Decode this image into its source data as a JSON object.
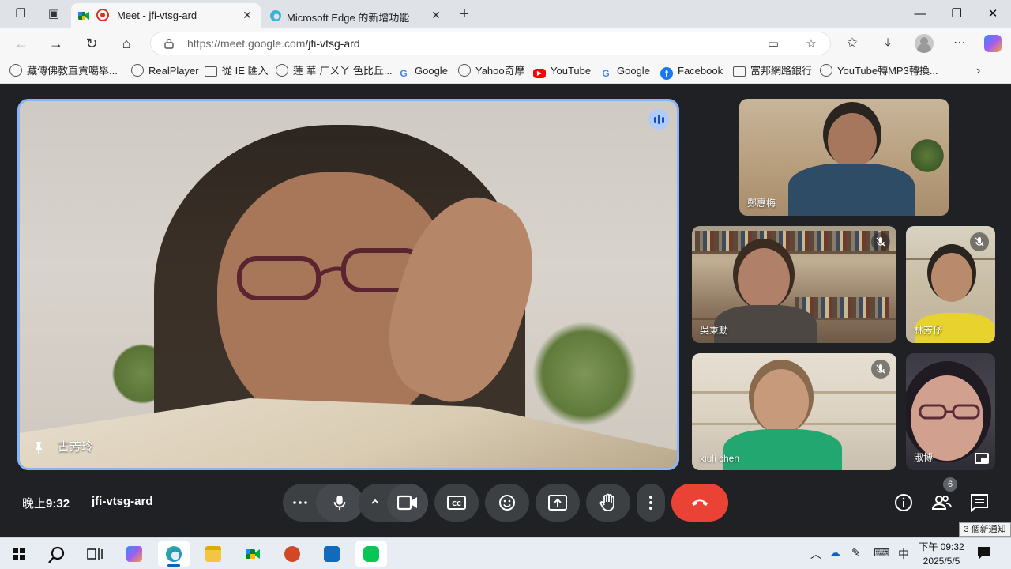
{
  "browser": {
    "tabs": [
      {
        "title": "Meet - jfi-vtsg-ard",
        "active": true
      },
      {
        "title": "Microsoft Edge 的新增功能",
        "active": false
      }
    ],
    "url_host": "https://meet.google.com",
    "url_path": "/jfi-vtsg-ard",
    "bookmarks": [
      {
        "label": "藏傳佛教直貢噶舉...",
        "icon": "globe-icon"
      },
      {
        "label": "RealPlayer",
        "icon": "globe-icon"
      },
      {
        "label": "從 IE 匯入",
        "icon": "folder-icon"
      },
      {
        "label": "蓮 華 ㄏㄨㄚ 色比丘...",
        "icon": "globe-icon"
      },
      {
        "label": "Google",
        "icon": "google-icon"
      },
      {
        "label": "Yahoo奇摩",
        "icon": "globe-icon"
      },
      {
        "label": "YouTube",
        "icon": "youtube-icon"
      },
      {
        "label": "Google",
        "icon": "google-icon"
      },
      {
        "label": "Facebook",
        "icon": "facebook-icon"
      },
      {
        "label": "富邦網路銀行",
        "icon": "folder-icon"
      },
      {
        "label": "YouTube轉MP3轉換...",
        "icon": "globe-icon"
      }
    ]
  },
  "meet": {
    "main_participant": "古芳玲",
    "participants": [
      {
        "name": "鄭惠梅",
        "muted": false
      },
      {
        "name": "吳秉勳",
        "muted": true
      },
      {
        "name": "林芳伃",
        "muted": true
      },
      {
        "name": "xiuli chen",
        "muted": true
      },
      {
        "name": "淑博",
        "muted": false
      }
    ],
    "time": "晚上9:32",
    "time_prefix": "晚上",
    "time_value": "9:32",
    "meeting_code": "jfi-vtsg-ard",
    "people_count": "6"
  },
  "taskbar": {
    "notification_text": "3 個新通知",
    "ime": "中",
    "clock_time": "下午 09:32",
    "clock_date": "2025/5/5"
  },
  "colors": {
    "meet_bg": "#202124",
    "control_bg": "#3c4043",
    "end_call": "#ea4335",
    "speaking_border": "#8ab4f8"
  }
}
